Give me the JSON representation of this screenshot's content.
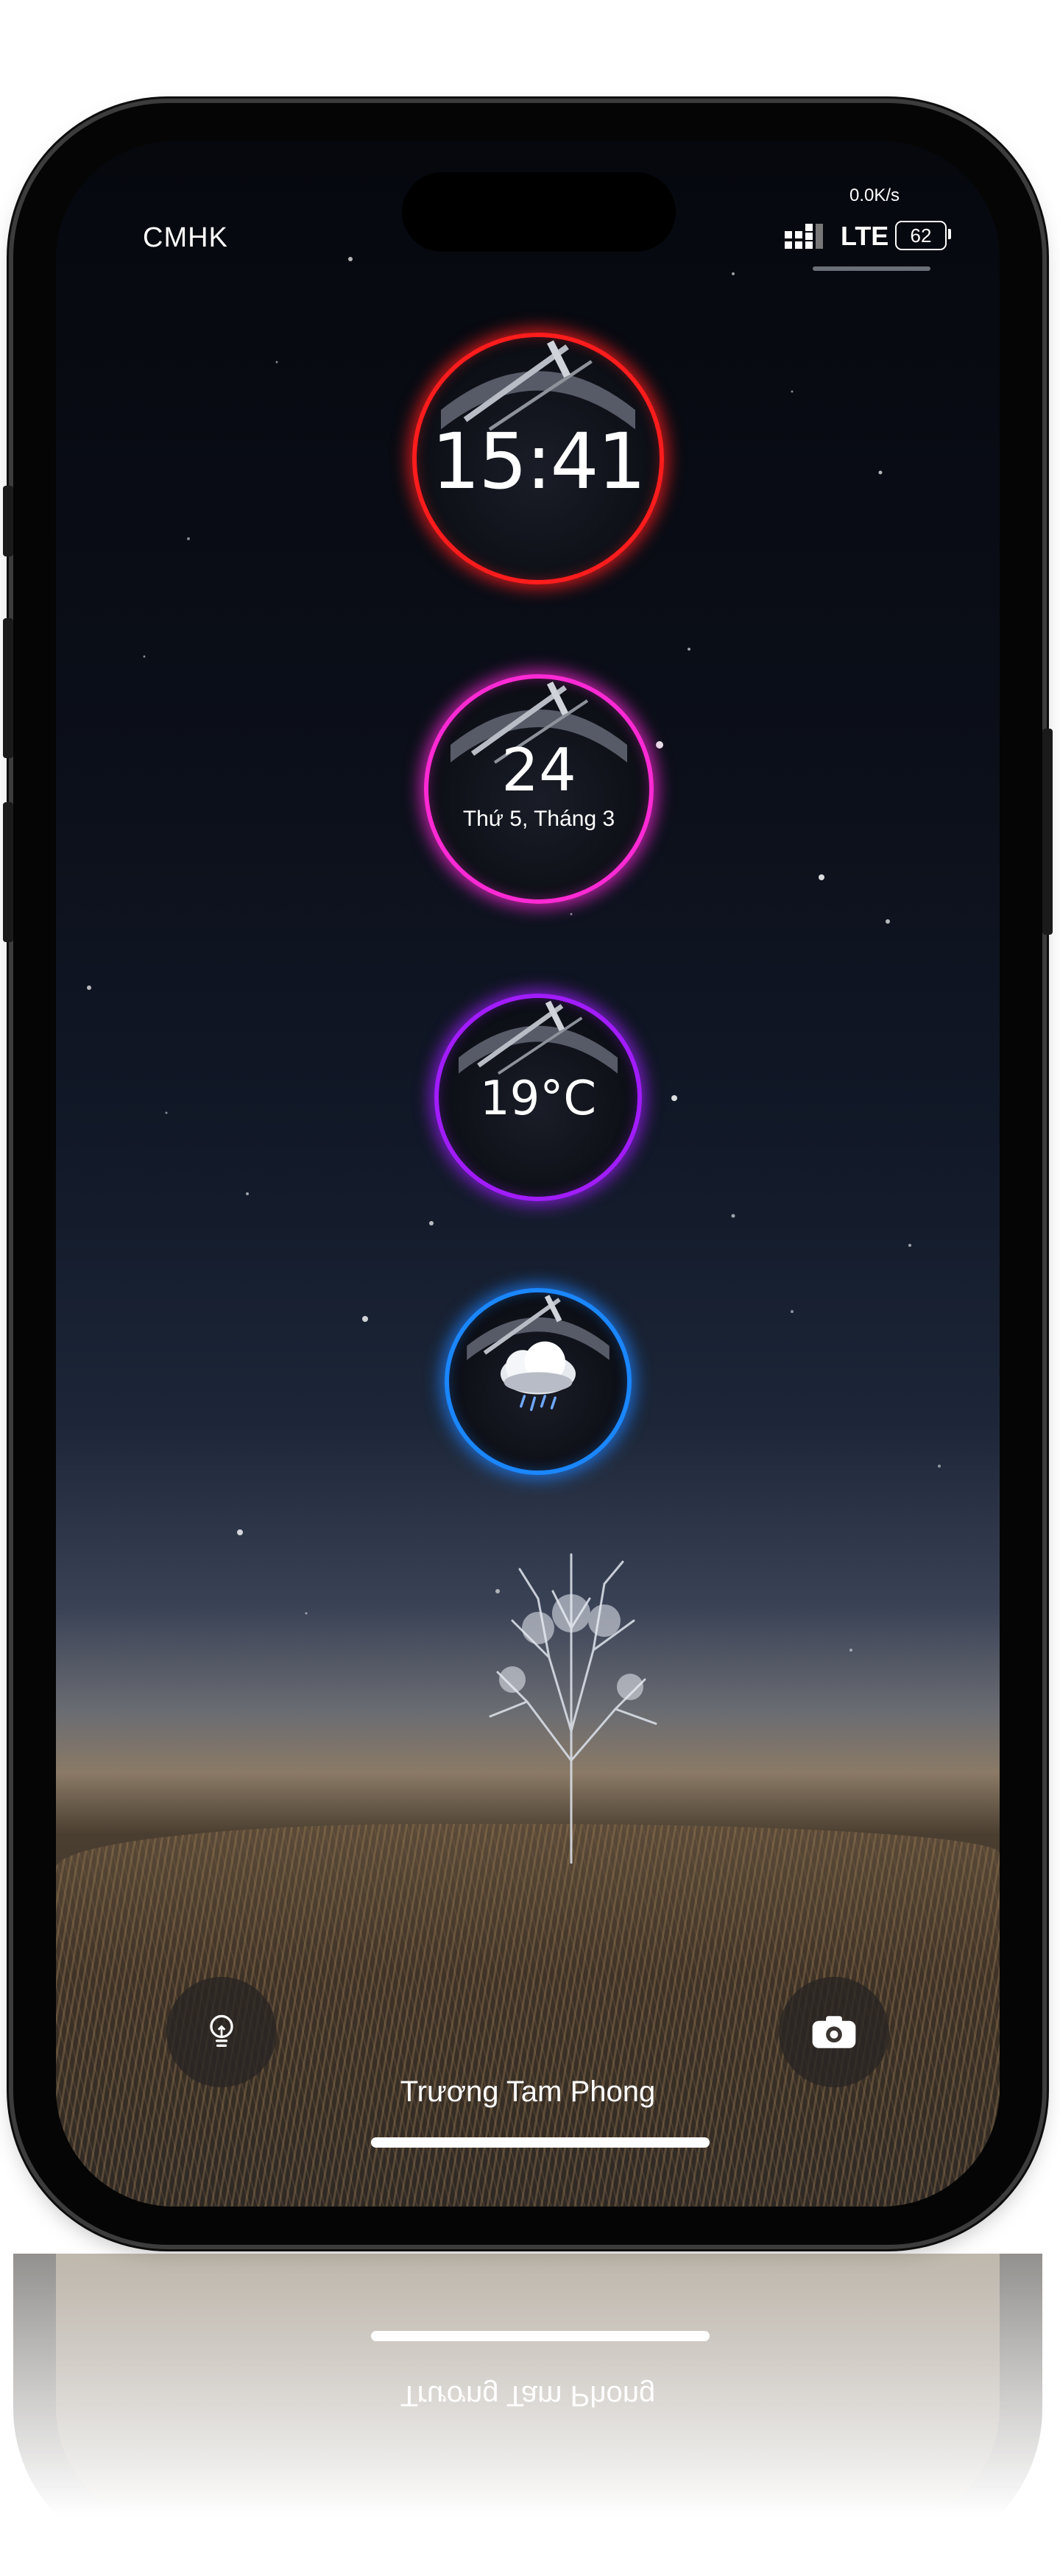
{
  "status_bar": {
    "carrier": "CMHK",
    "net_speed": "0.0K/s",
    "network_type": "LTE",
    "battery_level": "62"
  },
  "widgets": {
    "time": {
      "value": "15:41",
      "ring_color": "#ff1c1c"
    },
    "date": {
      "day": "24",
      "label": "Thứ 5, Tháng 3",
      "ring_color": "#ff2ad4"
    },
    "temperature": {
      "value": "19°C",
      "ring_color": "#a11cff"
    },
    "weather": {
      "icon": "cloud-rain-icon",
      "ring_color": "#1a86ff"
    }
  },
  "lockscreen": {
    "owner_name": "Trương Tam Phong",
    "left_button_icon": "flashlight-icon",
    "right_button_icon": "camera-icon"
  },
  "colors": {
    "sky_top": "#06080e",
    "horizon": "#8a7a66"
  }
}
